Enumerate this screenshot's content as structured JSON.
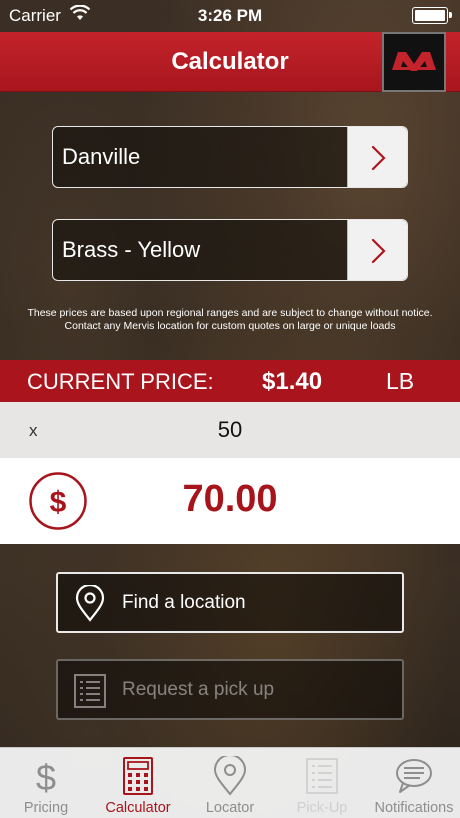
{
  "status_bar": {
    "carrier": "Carrier",
    "time": "3:26 PM",
    "wifi_icon": "wifi-icon",
    "battery_icon": "battery-icon"
  },
  "nav": {
    "title": "Calculator",
    "logo_icon": "mervis-logo"
  },
  "location_selector": {
    "value": "Danville",
    "icon": "chevron-right-icon"
  },
  "material_selector": {
    "value": "Brass - Yellow",
    "icon": "chevron-right-icon"
  },
  "disclaimer": {
    "line1": "These prices are based upon regional ranges and are subject to change without notice.",
    "line2": "Contact any Mervis location for custom quotes on large or unique loads"
  },
  "price": {
    "label": "CURRENT PRICE:",
    "value": "$1.40",
    "unit": "LB"
  },
  "quantity": {
    "multiplier": "x",
    "value": "50"
  },
  "total": {
    "icon": "dollar-icon",
    "value": "70.00"
  },
  "actions": [
    {
      "label": "Find a location",
      "icon": "map-pin-icon",
      "enabled": true
    },
    {
      "label": "Request a pick up",
      "icon": "list-icon",
      "enabled": false
    }
  ],
  "tabs": [
    {
      "label": "Pricing",
      "icon": "dollar-sign-icon",
      "state": "normal"
    },
    {
      "label": "Calculator",
      "icon": "calculator-icon",
      "state": "active"
    },
    {
      "label": "Locator",
      "icon": "map-pin-icon",
      "state": "normal"
    },
    {
      "label": "Pick-Up",
      "icon": "list-icon",
      "state": "disabled"
    },
    {
      "label": "Notifications",
      "icon": "speech-bubble-icon",
      "state": "normal"
    }
  ],
  "colors": {
    "brand_red": "#aa141c",
    "nav_red": "#c4232b",
    "total_red": "#a8141c",
    "tab_inactive": "#8e8e8e"
  }
}
